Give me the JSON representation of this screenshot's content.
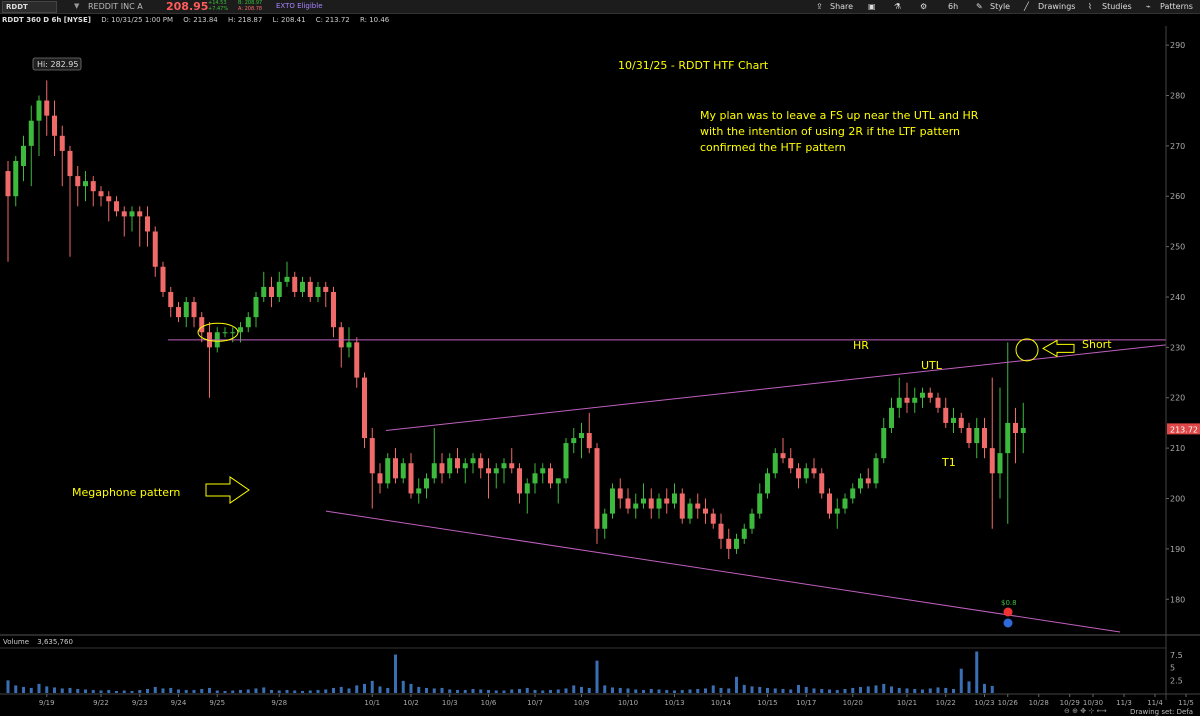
{
  "toolbar": {
    "symbol": "RDDT",
    "company": "REDDIT INC A",
    "last_price": "208.95",
    "change": "+14.53",
    "change_pct": "+7.47%",
    "bid": "B: 208.97",
    "ask": "A: 208.78",
    "exto": "EXTO Eligible",
    "share": "Share",
    "timeframe": "6h",
    "style": "Style",
    "drawings": "Drawings",
    "studies": "Studies",
    "patterns": "Patterns"
  },
  "header": {
    "title": "RDDT 360 D 6h [NYSE]",
    "date": "D: 10/31/25 1:00 PM",
    "open": "O: 213.84",
    "high": "H: 218.87",
    "low": "L: 208.41",
    "close": "C: 213.72",
    "range": "R: 10.46"
  },
  "volume_header": {
    "label": "Volume",
    "value": "3,635,760"
  },
  "annotations": {
    "hi_label": "Hi: 282.95",
    "title": "10/31/25 - RDDT HTF Chart",
    "plan_line1": "My plan was to leave a FS up near the UTL and HR",
    "plan_line2": "with the intention of using 2R if the LTF pattern",
    "plan_line3": "confirmed the HTF pattern",
    "hr": "HR",
    "utl": "UTL",
    "short": "Short",
    "t1": "T1",
    "megaphone": "Megaphone pattern",
    "marker_value": "$0.8",
    "current_price_tag": "213.72"
  },
  "status": {
    "drawing_set": "Drawing set: Defa"
  },
  "colors": {
    "up": "#3dba3d",
    "down": "#f06a6a",
    "trendline": "#c060c0",
    "annotation": "#ffff00",
    "volume": "#3b6fb5"
  },
  "chart_data": {
    "type": "candlestick",
    "timeframe": "6h",
    "y_axis_ticks": [
      290,
      280,
      270,
      260,
      250,
      240,
      230,
      220,
      210,
      200,
      190,
      180
    ],
    "ylim": [
      173.5,
      293
    ],
    "x_tick_labels": [
      "9/19",
      "9/22",
      "9/23",
      "9/24",
      "9/25",
      "9/28",
      "10/1",
      "10/2",
      "10/3",
      "10/6",
      "10/7",
      "10/9",
      "10/10",
      "10/13",
      "10/14",
      "10/15",
      "10/17",
      "10/20",
      "10/21",
      "10/22",
      "10/23",
      "10/26",
      "10/28",
      "10/29",
      "10/30",
      "11/3",
      "11/4",
      "11/5"
    ],
    "volume_axis_ticks": [
      "7.5",
      "5",
      "2.5"
    ],
    "volume_ylim": [
      0,
      8.5
    ],
    "horizontal_resistance": 231.5,
    "candles": [
      [
        265,
        267,
        247,
        260
      ],
      [
        260,
        268,
        258,
        267
      ],
      [
        266,
        272,
        263,
        270
      ],
      [
        270,
        278,
        262,
        275
      ],
      [
        275,
        280,
        268,
        279
      ],
      [
        279,
        283,
        272,
        276
      ],
      [
        276,
        279,
        268,
        272
      ],
      [
        272,
        274,
        262,
        269
      ],
      [
        269,
        270,
        248,
        264
      ],
      [
        264,
        266,
        258,
        262
      ],
      [
        262,
        265,
        259,
        263
      ],
      [
        263,
        264,
        258,
        261
      ],
      [
        261,
        262,
        258,
        260
      ],
      [
        260,
        261,
        255,
        259
      ],
      [
        259,
        260,
        256,
        257
      ],
      [
        257,
        258,
        252,
        256
      ],
      [
        256,
        258,
        253,
        257
      ],
      [
        257,
        258,
        250,
        256
      ],
      [
        256,
        258,
        250,
        253
      ],
      [
        253,
        254,
        244,
        246
      ],
      [
        246,
        247,
        240,
        241
      ],
      [
        241,
        242,
        236,
        238
      ],
      [
        238,
        239,
        235,
        236
      ],
      [
        236,
        240,
        234,
        239
      ],
      [
        239,
        240,
        234,
        236
      ],
      [
        236,
        237,
        231,
        233
      ],
      [
        233,
        235,
        220,
        230
      ],
      [
        230,
        234,
        229,
        233
      ],
      [
        233,
        234,
        232,
        233
      ],
      [
        233,
        234,
        231,
        233
      ],
      [
        233,
        235,
        231,
        234
      ],
      [
        234,
        237,
        233,
        236
      ],
      [
        236,
        241,
        234,
        240
      ],
      [
        240,
        245,
        239,
        242
      ],
      [
        242,
        244,
        238,
        240
      ],
      [
        240,
        245,
        239,
        243
      ],
      [
        243,
        247,
        242,
        244
      ],
      [
        244,
        245,
        240,
        241
      ],
      [
        241,
        244,
        240,
        243
      ],
      [
        243,
        244,
        239,
        240
      ],
      [
        240,
        243,
        239,
        242
      ],
      [
        242,
        243,
        238,
        241
      ],
      [
        241,
        242,
        232,
        234
      ],
      [
        234,
        235,
        226,
        230
      ],
      [
        230,
        234,
        228,
        231
      ],
      [
        231,
        232,
        222,
        224
      ],
      [
        224,
        225,
        210,
        212
      ],
      [
        212,
        214,
        198,
        205
      ],
      [
        205,
        207,
        201,
        203
      ],
      [
        203,
        209,
        202,
        208
      ],
      [
        208,
        210,
        203,
        204
      ],
      [
        204,
        208,
        203,
        207
      ],
      [
        207,
        209,
        200,
        201
      ],
      [
        201,
        204,
        199,
        202
      ],
      [
        202,
        205,
        200,
        204
      ],
      [
        204,
        214,
        203,
        207
      ],
      [
        207,
        209,
        203,
        205
      ],
      [
        205,
        209,
        204,
        208
      ],
      [
        208,
        210,
        205,
        206
      ],
      [
        206,
        208,
        203,
        207
      ],
      [
        207,
        209,
        205,
        208
      ],
      [
        208,
        209,
        204,
        206
      ],
      [
        206,
        208,
        200,
        205
      ],
      [
        205,
        207,
        202,
        206
      ],
      [
        206,
        208,
        203,
        207
      ],
      [
        207,
        210,
        205,
        206
      ],
      [
        206,
        207,
        199,
        201
      ],
      [
        201,
        204,
        197,
        203
      ],
      [
        203,
        207,
        201,
        205
      ],
      [
        205,
        207,
        203,
        206
      ],
      [
        206,
        207,
        202,
        203
      ],
      [
        203,
        204,
        199,
        204
      ],
      [
        204,
        212,
        203,
        211
      ],
      [
        211,
        214,
        209,
        212
      ],
      [
        212,
        215,
        208,
        213
      ],
      [
        213,
        217,
        209,
        210
      ],
      [
        210,
        211,
        191,
        194
      ],
      [
        194,
        198,
        192,
        197
      ],
      [
        197,
        203,
        196,
        202
      ],
      [
        202,
        204,
        198,
        200
      ],
      [
        200,
        202,
        197,
        198
      ],
      [
        198,
        201,
        196,
        199
      ],
      [
        199,
        203,
        198,
        200
      ],
      [
        200,
        202,
        196,
        198
      ],
      [
        198,
        201,
        196,
        200
      ],
      [
        200,
        202,
        197,
        199
      ],
      [
        199,
        203,
        198,
        201
      ],
      [
        201,
        202,
        195,
        196
      ],
      [
        196,
        200,
        195,
        199
      ],
      [
        199,
        201,
        196,
        198
      ],
      [
        198,
        200,
        195,
        197
      ],
      [
        197,
        198,
        194,
        195
      ],
      [
        195,
        197,
        190,
        192
      ],
      [
        192,
        194,
        188,
        190
      ],
      [
        190,
        193,
        189,
        192
      ],
      [
        192,
        195,
        191,
        194
      ],
      [
        194,
        198,
        193,
        197
      ],
      [
        197,
        203,
        196,
        201
      ],
      [
        201,
        206,
        200,
        205
      ],
      [
        205,
        210,
        204,
        209
      ],
      [
        209,
        212,
        207,
        208
      ],
      [
        208,
        210,
        205,
        206
      ],
      [
        206,
        207,
        202,
        204
      ],
      [
        204,
        207,
        203,
        206
      ],
      [
        206,
        208,
        204,
        205
      ],
      [
        205,
        206,
        200,
        201
      ],
      [
        201,
        202,
        196,
        197
      ],
      [
        197,
        200,
        194,
        198
      ],
      [
        198,
        201,
        197,
        200
      ],
      [
        200,
        203,
        199,
        202
      ],
      [
        202,
        205,
        201,
        204
      ],
      [
        204,
        206,
        202,
        203
      ],
      [
        203,
        209,
        202,
        208
      ],
      [
        208,
        216,
        207,
        214
      ],
      [
        214,
        220,
        213,
        218
      ],
      [
        218,
        224,
        216,
        220
      ],
      [
        220,
        223,
        217,
        219
      ],
      [
        219,
        222,
        217,
        220
      ],
      [
        220,
        222,
        218,
        221
      ],
      [
        221,
        222,
        219,
        220
      ],
      [
        220,
        221,
        217,
        218
      ],
      [
        218,
        220,
        214,
        215
      ],
      [
        215,
        218,
        213,
        216
      ],
      [
        216,
        217,
        213,
        214
      ],
      [
        214,
        215,
        210,
        211
      ],
      [
        211,
        216,
        208,
        214
      ],
      [
        214,
        216,
        208,
        210
      ],
      [
        210,
        224,
        194,
        205
      ],
      [
        205,
        222,
        200,
        209
      ],
      [
        209,
        231,
        195,
        215
      ],
      [
        215,
        218,
        207,
        213
      ],
      [
        213,
        219,
        209,
        214
      ]
    ],
    "volume_profile": [
      2.5,
      1.5,
      1.2,
      1.0,
      1.8,
      1.3,
      1.1,
      0.9,
      1.0,
      0.8,
      0.7,
      0.6,
      0.5,
      0.6,
      0.4,
      0.5,
      0.4,
      0.6,
      0.8,
      1.2,
      0.9,
      1.0,
      0.7,
      0.6,
      0.6,
      0.8,
      1.0,
      0.5,
      0.4,
      0.5,
      0.6,
      0.7,
      0.9,
      1.1,
      0.6,
      0.5,
      0.6,
      0.5,
      0.4,
      0.5,
      0.6,
      0.7,
      1.0,
      1.2,
      0.9,
      1.5,
      1.8,
      2.4,
      1.3,
      1.0,
      7.6,
      2.4,
      1.8,
      1.2,
      1.0,
      0.9,
      1.0,
      0.7,
      0.6,
      0.6,
      0.8,
      0.7,
      0.6,
      0.5,
      0.5,
      0.7,
      0.8,
      1.0,
      0.6,
      0.5,
      0.6,
      0.7,
      0.9,
      1.5,
      1.2,
      1.0,
      6.4,
      1.5,
      1.1,
      1.0,
      0.9,
      0.7,
      0.6,
      0.8,
      0.7,
      0.6,
      0.5,
      0.6,
      0.7,
      0.8,
      0.9,
      1.5,
      1.0,
      0.9,
      3.2,
      1.6,
      1.3,
      1.2,
      1.0,
      0.9,
      0.8,
      0.7,
      1.6,
      1.2,
      0.9,
      0.8,
      0.7,
      0.6,
      0.8,
      1.0,
      1.2,
      1.3,
      1.5,
      1.8,
      1.3,
      1.0,
      0.9,
      0.8,
      0.7,
      0.9,
      1.1,
      1.0,
      0.8,
      4.8,
      2.3,
      8.2,
      1.8,
      1.4
    ]
  }
}
